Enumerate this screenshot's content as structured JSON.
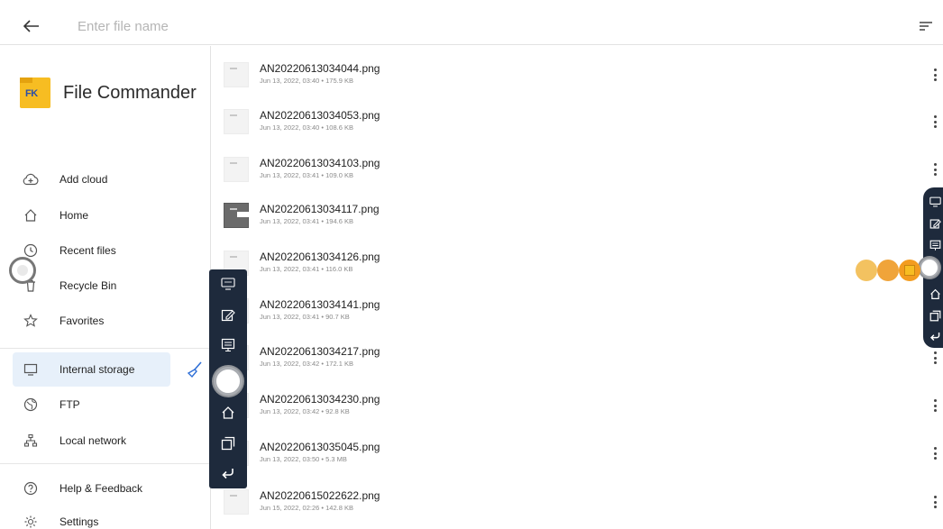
{
  "header": {
    "search_placeholder": "Enter file name"
  },
  "sidebar": {
    "app_name": "File Commander",
    "logo_text": "FK",
    "items": [
      {
        "label": "Add cloud",
        "icon": "cloud-add-icon"
      },
      {
        "label": "Home",
        "icon": "home-icon"
      },
      {
        "label": "Recent files",
        "icon": "clock-icon"
      },
      {
        "label": "Recycle Bin",
        "icon": "trash-icon"
      },
      {
        "label": "Favorites",
        "icon": "star-icon"
      },
      {
        "label": "Internal storage",
        "icon": "device-icon",
        "active": true
      },
      {
        "label": "FTP",
        "icon": "globe-icon"
      },
      {
        "label": "Local network",
        "icon": "network-icon"
      },
      {
        "label": "Help & Feedback",
        "icon": "help-icon"
      },
      {
        "label": "Settings",
        "icon": "gear-icon"
      }
    ]
  },
  "files": [
    {
      "name": "AN20220613034044.png",
      "date": "Jun 13, 2022, 03:40",
      "size": "175.9 KB"
    },
    {
      "name": "AN20220613034053.png",
      "date": "Jun 13, 2022, 03:40",
      "size": "108.6 KB"
    },
    {
      "name": "AN20220613034103.png",
      "date": "Jun 13, 2022, 03:41",
      "size": "109.0 KB"
    },
    {
      "name": "AN20220613034117.png",
      "date": "Jun 13, 2022, 03:41",
      "size": "194.6 KB"
    },
    {
      "name": "AN20220613034126.png",
      "date": "Jun 13, 2022, 03:41",
      "size": "116.0 KB"
    },
    {
      "name": "AN20220613034141.png",
      "date": "Jun 13, 2022, 03:41",
      "size": "90.7 KB"
    },
    {
      "name": "AN20220613034217.png",
      "date": "Jun 13, 2022, 03:42",
      "size": "172.1 KB"
    },
    {
      "name": "AN20220613034230.png",
      "date": "Jun 13, 2022, 03:42",
      "size": "92.8 KB"
    },
    {
      "name": "AN20220613035045.png",
      "date": "Jun 13, 2022, 03:50",
      "size": "5.3 MB"
    },
    {
      "name": "AN20220615022622.png",
      "date": "Jun 15, 2022, 02:26",
      "size": "142.8 KB"
    }
  ],
  "meta_separator": " • ",
  "colors": {
    "accent": "#1a73e8",
    "active_bg": "#e7f0fa",
    "toolbar_bg": "#1e2a3c",
    "logo_yellow": "#f7bd22",
    "bubble_1": "#f3c260",
    "bubble_2": "#f0a43a",
    "bubble_3": "#f39c1f"
  }
}
